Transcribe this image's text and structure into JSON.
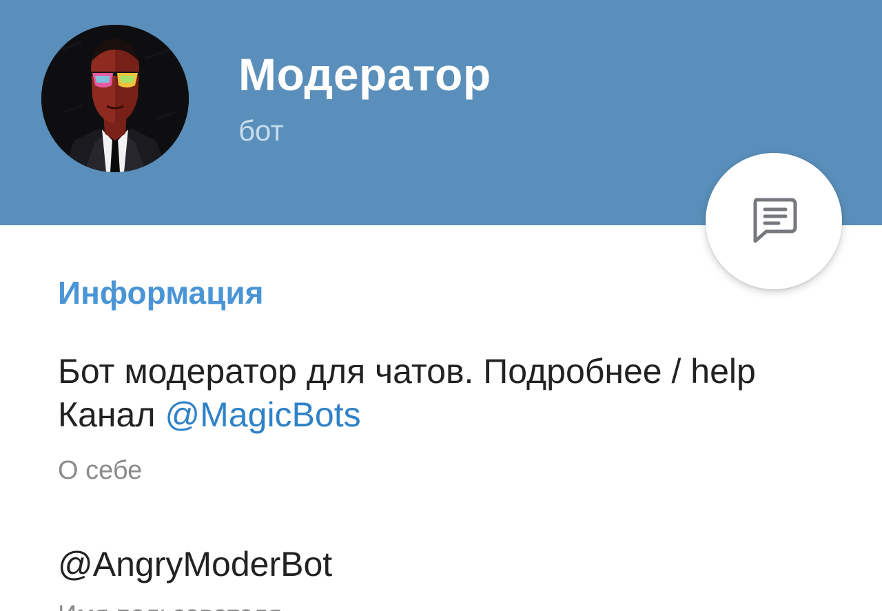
{
  "profile": {
    "name": "Модератор",
    "status": "бот",
    "avatar_icon": "bot-avatar-man-in-suit"
  },
  "actions": {
    "message_icon": "message-icon"
  },
  "info": {
    "section_title": "Информация",
    "bio_text": "Бот модератор для чатов. Подробнее / help Канал ",
    "bio_link": "@MagicBots",
    "bio_caption": "О себе",
    "username": "@AngryModerBot",
    "username_caption": "Имя пользователя"
  },
  "colors": {
    "header_bg": "#5a8fbb",
    "accent": "#4a95d6",
    "link": "#2f82c7",
    "text": "#222222",
    "caption": "#8b8b8b"
  }
}
